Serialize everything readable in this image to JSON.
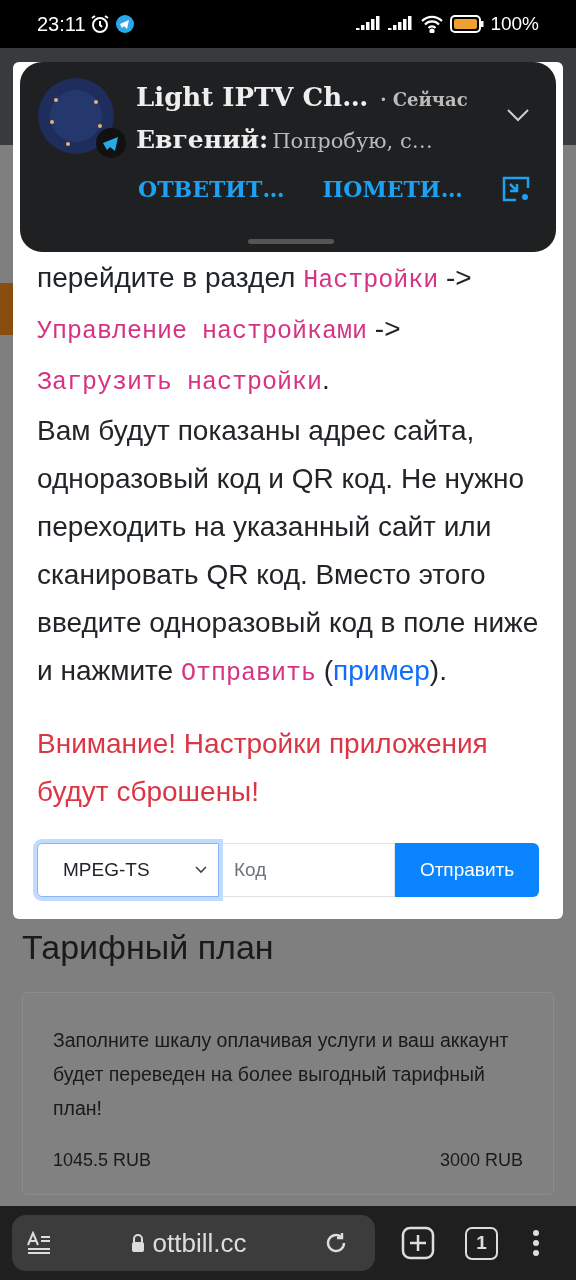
{
  "status_bar": {
    "time": "23:11",
    "battery": "100%"
  },
  "notification": {
    "app_title": "Light IPTV Ch…",
    "time": "· Сейчас",
    "sender": "Евгений:",
    "message": "Попробую, с…",
    "actions": [
      "ОТВЕТИТ…",
      "ПОМЕТИ…"
    ]
  },
  "modal": {
    "paragraphs": [
      [
        {
          "kind": "text",
          "text": "перейдите в раздел "
        },
        {
          "kind": "code",
          "text": "Настройки"
        },
        {
          "kind": "text",
          "text": " -> "
        },
        {
          "kind": "code",
          "text": "Управление настройками"
        },
        {
          "kind": "text",
          "text": " -> "
        },
        {
          "kind": "code",
          "text": "Загрузить настройки"
        },
        {
          "kind": "text",
          "text": "."
        }
      ],
      [
        {
          "kind": "text",
          "text": "Вам будут показаны адрес сайта, одноразовый код и QR код. Не нужно переходить на указанный сайт или сканировать QR код. Вместо этого введите одноразовый код в поле ниже и нажмите "
        },
        {
          "kind": "code",
          "text": "Отправить"
        },
        {
          "kind": "text",
          "text": " ("
        },
        {
          "kind": "link",
          "text": "пример"
        },
        {
          "kind": "text",
          "text": ")."
        }
      ]
    ],
    "warning": "Внимание! Настройки приложения будут сброшены!",
    "format_select": "MPEG-TS",
    "code_placeholder": "Код",
    "submit": "Отправить"
  },
  "tariff": {
    "title": "Тарифный план",
    "description": "Заполните шкалу оплачивая услуги и ваш аккаунт будет переведен на более выгодный тарифный план!",
    "current": "1045.5 RUB",
    "target": "3000 RUB"
  },
  "browser": {
    "url": "ottbill.cc",
    "tab_count": "1"
  }
}
